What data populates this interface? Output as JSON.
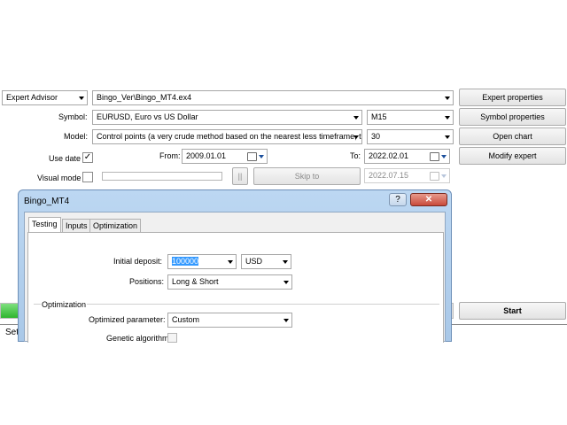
{
  "tester": {
    "mode_select": "Expert Advisor",
    "expert_path": "Bingo_Ver\\Bingo_MT4.ex4",
    "symbol_label": "Symbol:",
    "symbol_value": "EURUSD, Euro vs US Dollar",
    "period_value": "M15",
    "model_label": "Model:",
    "model_value": "Control points (a very crude method based on the nearest less timeframe, th",
    "spread_value": "30",
    "use_date_label": "Use date",
    "use_date_checked": "✓",
    "from_label": "From:",
    "from_value": "2009.01.01",
    "to_label": "To:",
    "to_value": "2022.02.01",
    "visual_mode_label": "Visual mode",
    "pause_label": "||",
    "skip_to_label": "Skip to",
    "skip_date_value": "2022.07.15",
    "buttons": {
      "expert_properties": "Expert properties",
      "symbol_properties": "Symbol properties",
      "open_chart": "Open chart",
      "modify_expert": "Modify expert",
      "start": "Start"
    },
    "bottom_tab_partial": "Set"
  },
  "dialog": {
    "title": "Bingo_MT4",
    "help_glyph": "?",
    "close_glyph": "✕",
    "tabs": [
      "Testing",
      "Inputs",
      "Optimization"
    ],
    "initial_deposit_label": "Initial deposit:",
    "initial_deposit_value": "100000",
    "currency_value": "USD",
    "positions_label": "Positions:",
    "positions_value": "Long & Short",
    "optimization_group": "Optimization",
    "optimized_parameter_label": "Optimized parameter:",
    "optimized_parameter_value": "Custom",
    "genetic_algorithm_label": "Genetic algorithm"
  },
  "colors": {
    "selection": "#3399ff",
    "close_button": "#c94a3b",
    "dialog_frame": "#aecdec",
    "progress_green": "#3fbf3f"
  }
}
